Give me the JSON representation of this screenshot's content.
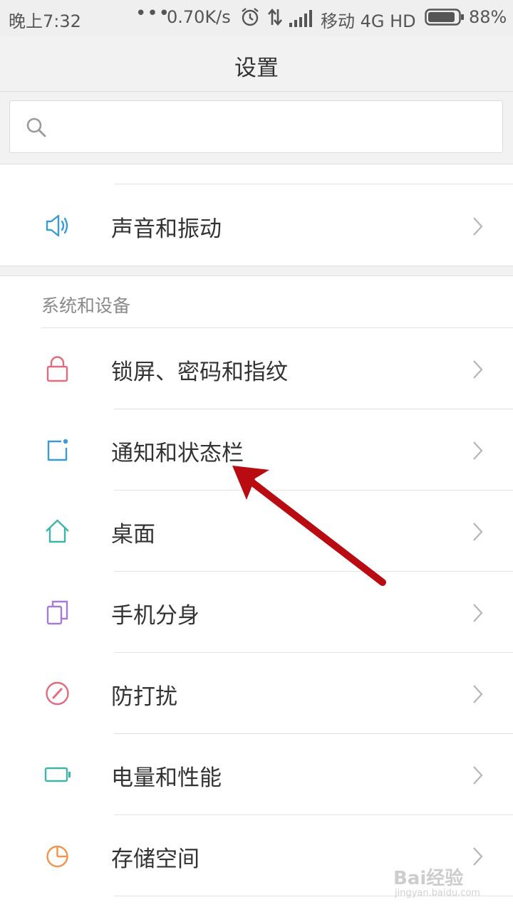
{
  "status_bar": {
    "time": "晚上7:32",
    "dots": "•••",
    "net_speed": "0.70K/s",
    "carrier": "移动 4G HD",
    "battery_percent": "88%",
    "battery_level": 0.88,
    "icons": [
      "alarm-icon",
      "data-transfer-icon",
      "signal-icon",
      "battery-icon"
    ]
  },
  "header": {
    "title": "设置"
  },
  "search": {
    "value": "",
    "placeholder": "",
    "icon": "search-icon"
  },
  "top_group": {
    "items": [
      {
        "label": "声音和振动",
        "icon": "speaker-icon",
        "color": "#3a9bd5"
      }
    ]
  },
  "system_section": {
    "header": "系统和设备",
    "items": [
      {
        "label": "锁屏、密码和指纹",
        "icon": "lock-icon",
        "color": "#e06c7e"
      },
      {
        "label": "通知和状态栏",
        "icon": "notification-icon",
        "color": "#3a9bd5"
      },
      {
        "label": "桌面",
        "icon": "home-icon",
        "color": "#3fb4a8"
      },
      {
        "label": "手机分身",
        "icon": "second-space-icon",
        "color": "#a77ad8"
      },
      {
        "label": "防打扰",
        "icon": "do-not-disturb-icon",
        "color": "#e06c7e"
      },
      {
        "label": "电量和性能",
        "icon": "battery-icon",
        "color": "#3fb4a8"
      },
      {
        "label": "存储空间",
        "icon": "storage-pie-icon",
        "color": "#f0944e"
      }
    ]
  },
  "chevron_icon": "chevron-right-icon",
  "annotation": {
    "icon": "red-arrow-icon",
    "color": "#b80c12"
  },
  "watermark": {
    "logo": "Bai经验",
    "url": "jingyan.baidu.com"
  }
}
